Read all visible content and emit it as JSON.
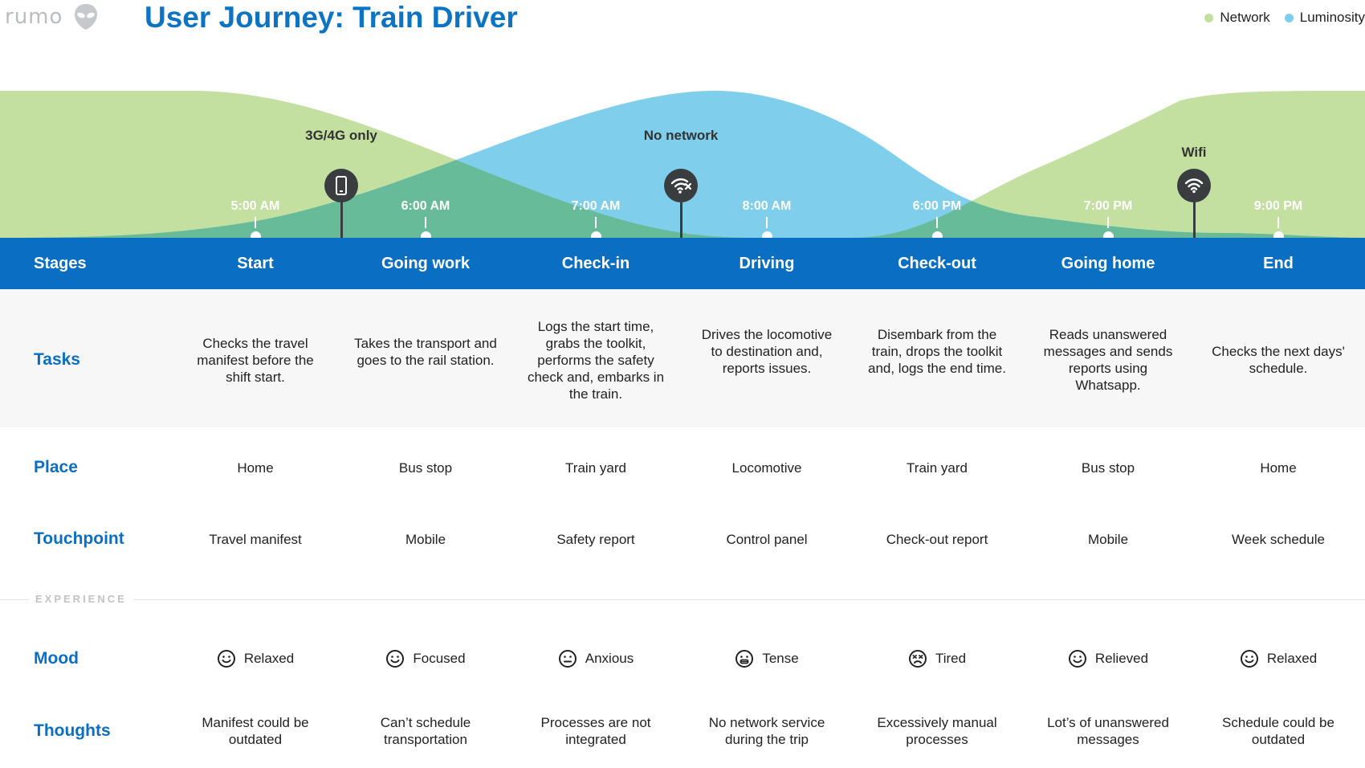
{
  "header": {
    "logo_text": "rumo",
    "title": "User Journey: Train Driver"
  },
  "legend": [
    {
      "label": "Network",
      "color": "#c3e0a0"
    },
    {
      "label": "Luminosity",
      "color": "#7fcfec"
    }
  ],
  "colors": {
    "network": "#c3e0a0",
    "luminosity": "#7fcfec",
    "overlap": "#67bb98",
    "accent": "#0a6fc2",
    "pin": "#3a3d40"
  },
  "times": [
    "5:00 AM",
    "6:00 AM",
    "7:00 AM",
    "8:00 AM",
    "6:00 PM",
    "7:00 PM",
    "9:00 PM"
  ],
  "pins": [
    {
      "label": "3G/4G only",
      "icon": "mobile-phone-icon"
    },
    {
      "label": "No network",
      "icon": "wifi-off-icon"
    },
    {
      "label": "Wifi",
      "icon": "wifi-icon"
    }
  ],
  "stages": {
    "label": "Stages",
    "items": [
      "Start",
      "Going work",
      "Check-in",
      "Driving",
      "Check-out",
      "Going home",
      "End"
    ]
  },
  "tasks": {
    "label": "Tasks",
    "items": [
      "Checks the travel manifest before the shift start.",
      "Takes the transport and goes to the rail station.",
      "Logs the start time, grabs the toolkit, performs the safety check and, embarks in the train.",
      "Drives the locomotive to destination and, reports issues.",
      "Disembark from the train, drops the toolkit and, logs the end time.",
      "Reads unanswered messages and sends reports using Whatsapp.",
      "Checks the next days' schedule."
    ]
  },
  "place": {
    "label": "Place",
    "items": [
      "Home",
      "Bus stop",
      "Train yard",
      "Locomotive",
      "Train yard",
      "Bus stop",
      "Home"
    ]
  },
  "touchpoint": {
    "label": "Touchpoint",
    "items": [
      "Travel manifest",
      "Mobile",
      "Safety report",
      "Control panel",
      "Check-out report",
      "Mobile",
      "Week schedule"
    ]
  },
  "experience_label": "EXPERIENCE",
  "mood": {
    "label": "Mood",
    "items": [
      {
        "text": "Relaxed",
        "icon": "smile-icon"
      },
      {
        "text": "Focused",
        "icon": "smile-icon"
      },
      {
        "text": "Anxious",
        "icon": "neutral-face-icon"
      },
      {
        "text": "Tense",
        "icon": "grimace-icon"
      },
      {
        "text": "Tired",
        "icon": "tired-face-icon"
      },
      {
        "text": "Relieved",
        "icon": "smile-icon"
      },
      {
        "text": "Relaxed",
        "icon": "smile-icon"
      }
    ]
  },
  "thoughts": {
    "label": "Thoughts",
    "items": [
      "Manifest could be outdated",
      "Can’t schedule transportation",
      "Processes are not integrated",
      "No network service during the trip",
      "Excessively manual processes",
      "Lot’s of unanswered messages",
      "Schedule could be outdated"
    ]
  }
}
